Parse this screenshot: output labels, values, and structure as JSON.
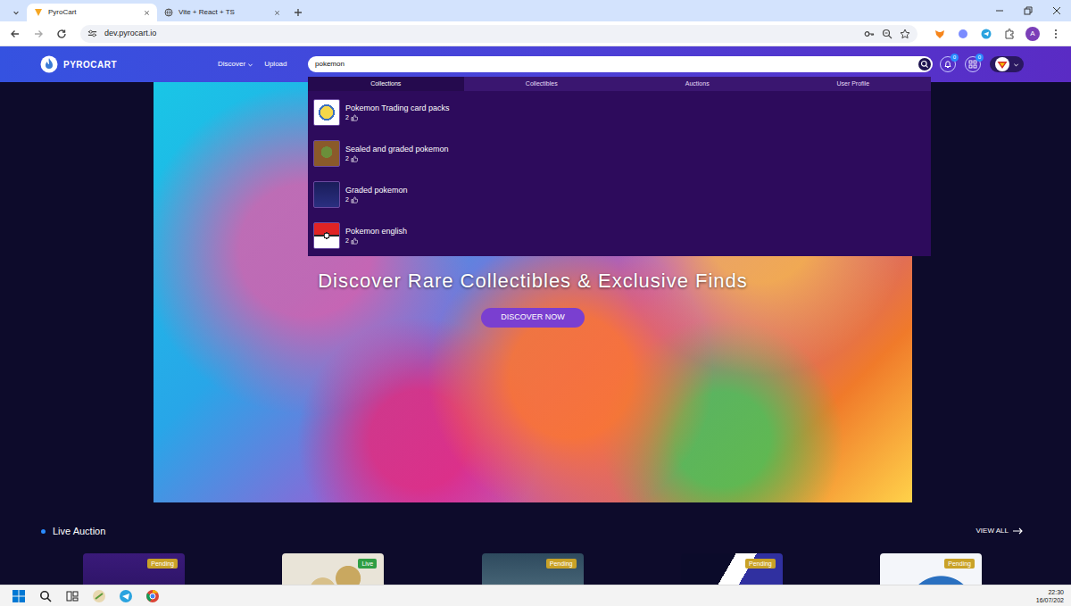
{
  "browser": {
    "tabs": [
      {
        "title": "PyroCart",
        "selected": true
      },
      {
        "title": "Vite + React + TS",
        "selected": false
      }
    ],
    "address": "dev.pyrocart.io",
    "profile_initial": "A"
  },
  "navbar": {
    "logo": "PYROCART",
    "links": [
      {
        "label": "Discover",
        "dropdown": true
      },
      {
        "label": "Upload",
        "dropdown": false
      }
    ],
    "search": {
      "value": "pokemon"
    },
    "badges": [
      "0",
      "0"
    ]
  },
  "search_results": {
    "tabs": [
      {
        "label": "Collections",
        "selected": true
      },
      {
        "label": "Collectibles",
        "selected": false
      },
      {
        "label": "Auctions",
        "selected": false
      },
      {
        "label": "User Profile",
        "selected": false
      }
    ],
    "items": [
      {
        "name": "Pokemon Trading card packs",
        "likes": "2"
      },
      {
        "name": "Sealed and graded pokemon",
        "likes": "2"
      },
      {
        "name": "Graded pokemon",
        "likes": "2"
      },
      {
        "name": "Pokemon english",
        "likes": "2"
      }
    ]
  },
  "hero": {
    "title": "Discover Rare Collectibles & Exclusive Finds",
    "button": "DISCOVER NOW"
  },
  "live_auction": {
    "title": "Live Auction",
    "view_all": "VIEW ALL",
    "cards": [
      {
        "status": "Pending",
        "color": "#c9a227"
      },
      {
        "status": "Live",
        "color": "#2f9e44"
      },
      {
        "status": "Pending",
        "color": "#c9a227"
      },
      {
        "status": "Pending",
        "color": "#c9a227"
      },
      {
        "status": "Pending",
        "color": "#c9a227"
      }
    ]
  },
  "taskbar": {
    "time": "22:30",
    "date": "16/07/202"
  }
}
